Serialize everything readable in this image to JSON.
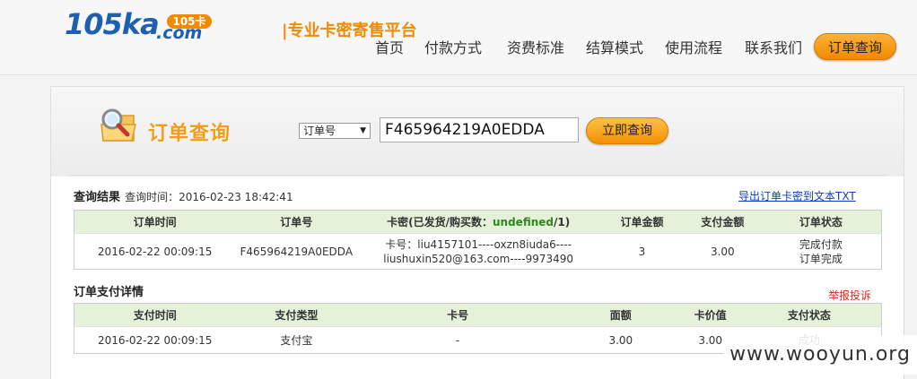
{
  "header": {
    "logo": {
      "number": "105",
      "ka": "ka",
      "com": ".com",
      "badge": "105卡",
      "slogan": "|专业卡密寄售平台"
    },
    "nav": [
      {
        "label": "首页"
      },
      {
        "label": "付款方式"
      },
      {
        "label": "资费标准"
      },
      {
        "label": "结算模式"
      },
      {
        "label": "使用流程"
      },
      {
        "label": "联系我们"
      }
    ],
    "order_query_button": "订单查询",
    "colors": {
      "brand_blue": "#1d5fb0",
      "brand_orange": "#f08a00"
    }
  },
  "search": {
    "title": "订单查询",
    "select_value": "订单号",
    "input_value": "F465964219A0EDDA",
    "query_button": "立即查询"
  },
  "results": {
    "title": "查询结果",
    "time_label": "查询时间：",
    "time": "2016-02-23 18:42:41",
    "export_link": "导出订单卡密到文本TXT",
    "columns": {
      "order_time": "订单时间",
      "order_no": "订单号",
      "card_prefix": "卡密(已发货/购买数：",
      "card_delivered": "undefined",
      "card_suffix": "/1)",
      "amount": "订单金额",
      "paid": "支付金额",
      "status": "订单状态"
    },
    "row": {
      "order_time": "2016-02-22 00:09:15",
      "order_no": "F465964219A0EDDA",
      "card_line1": "卡号：liu4157101----oxzn8iuda6----",
      "card_line2": "liushuxin520@163.com----9973490",
      "amount": "3",
      "paid": "3.00",
      "status_line1": "完成付款",
      "status_line2": "订单完成"
    }
  },
  "payment": {
    "title": "订单支付详情",
    "report_link": "举报投诉",
    "columns": {
      "pay_time": "支付时间",
      "pay_type": "支付类型",
      "card_no": "卡号",
      "face_value": "面额",
      "card_value": "卡价值",
      "pay_status": "支付状态"
    },
    "row": {
      "pay_time": "2016-02-22 00:09:15",
      "pay_type": "支付宝",
      "card_no": "-",
      "face_value": "3.00",
      "card_value": "3.00",
      "pay_status": "成功"
    }
  },
  "watermark": "www.wooyun.org"
}
